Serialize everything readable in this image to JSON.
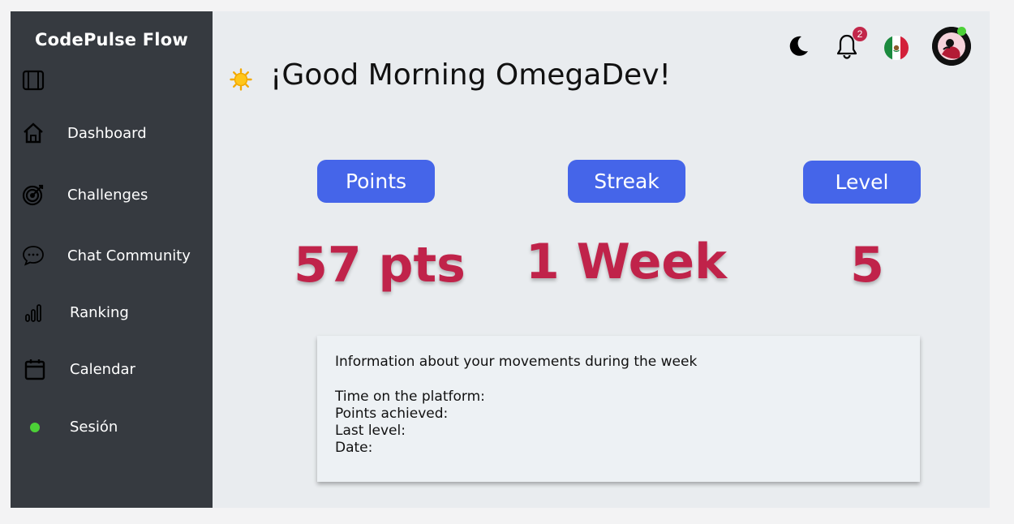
{
  "sidebar": {
    "title": "CodePulse Flow",
    "items": [
      {
        "label": "Dashboard",
        "icon": "home-icon"
      },
      {
        "label": "Challenges",
        "icon": "target-icon"
      },
      {
        "label": "Chat Community",
        "icon": "chat-bubble-icon"
      },
      {
        "label": "Ranking",
        "icon": "bar-chart-icon"
      },
      {
        "label": "Calendar",
        "icon": "calendar-icon"
      },
      {
        "label": "Sesión",
        "icon": "status-dot-icon"
      }
    ]
  },
  "header": {
    "greeting": "¡Good Morning OmegaDev!",
    "notification_count": "2"
  },
  "stats": [
    {
      "label": "Points",
      "value": "57 pts"
    },
    {
      "label": "Streak",
      "value": "1 Week"
    },
    {
      "label": "Level",
      "value": "5"
    }
  ],
  "info": {
    "heading": "Information about your movements during the week",
    "rows": [
      "Time on the platform:",
      "Points achieved:",
      "Last level:",
      "Date:"
    ]
  },
  "colors": {
    "sidebar": "#363a40",
    "accent": "#4565e9",
    "stat_value": "#c0234a",
    "badge": "#c2274a",
    "online": "#4cd137"
  }
}
